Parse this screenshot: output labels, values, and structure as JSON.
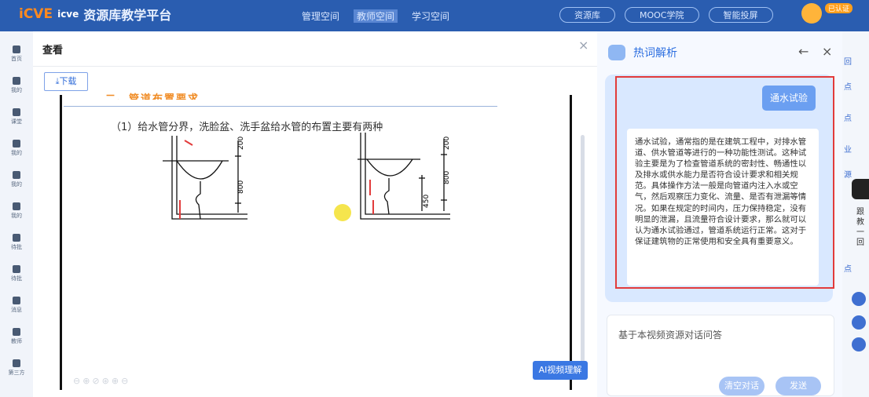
{
  "topbar": {
    "logo_mark": "iCVE",
    "logo_text_small": "icve",
    "platform_title": "资源库教学平台",
    "tabs": [
      "管理空间",
      "教师空间",
      "学习空间"
    ],
    "pills": [
      "资源库",
      "MOOC学院",
      "智能投屏"
    ],
    "user_badge": "已认证"
  },
  "sidebar": {
    "items": [
      "首页",
      "我的",
      "课堂",
      "我的",
      "我的",
      "我的",
      "待批",
      "待批",
      "消息",
      "教师",
      "第三方"
    ]
  },
  "modal": {
    "title": "查看",
    "close_glyph": "×",
    "download_label": "下载",
    "slide_heading": "二、管道布置要求",
    "slide_text": "（1）给水管分界，洗脸盆、洗手盆给水管的布置主要有两种",
    "ai_button": "AI视频理解",
    "diagram_dims": [
      "200",
      "800",
      "200",
      "800",
      "450"
    ]
  },
  "panel": {
    "title": "热词解析",
    "back_glyph": "←",
    "close_glyph": "×",
    "question": "通水试验",
    "answer": "通水试验，通常指的是在建筑工程中，对排水管道、供水管道等进行的一种功能性测试。这种试验主要是为了检查管道系统的密封性、畅通性以及排水或供水能力是否符合设计要求和相关规范。具体操作方法一般是向管道内注入水或空气，然后观察压力变化、流量、是否有泄漏等情况。如果在规定的时间内，压力保持稳定，没有明显的泄漏，且流量符合设计要求，那么就可以认为通水试验通过，管道系统运行正常。这对于保证建筑物的正常使用和安全具有重要意义。",
    "input_placeholder": "基于本视频资源对话问答",
    "clear_label": "清空对话",
    "send_label": "发送"
  },
  "right_strip": {
    "side_labels": [
      "回",
      "点",
      "点",
      "业",
      "源",
      "点"
    ],
    "vertical_text": "跟教一回"
  },
  "colors": {
    "primary": "#2f6bd8",
    "red_outline": "#e23b3b",
    "topbar": "#2a5db0"
  }
}
